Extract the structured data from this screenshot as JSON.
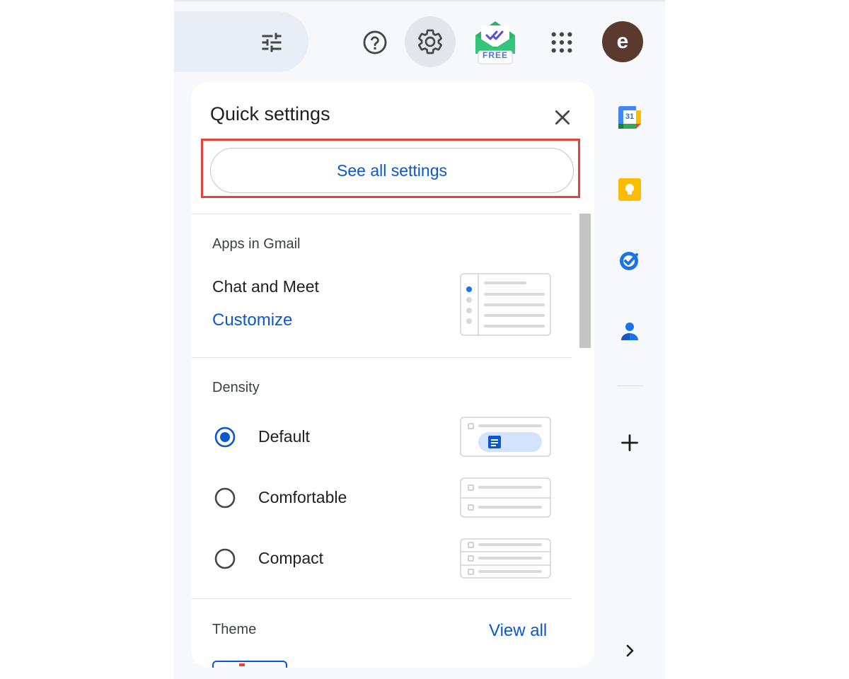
{
  "header": {
    "avatar_initial": "e",
    "extension_badge": "FREE"
  },
  "icons": {
    "filter": "tune-icon",
    "help": "help-circle-icon",
    "settings": "gear-icon",
    "apps": "apps-grid-icon",
    "close": "close-icon",
    "side_calendar": "google-calendar-icon",
    "side_keep": "google-keep-icon",
    "side_tasks": "google-tasks-icon",
    "side_contacts": "google-contacts-icon",
    "side_add": "plus-icon",
    "side_expand": "chevron-right-icon"
  },
  "calendar_day": "31",
  "quick_settings": {
    "title": "Quick settings",
    "see_all": "See all settings",
    "apps_section": {
      "label": "Apps in Gmail",
      "item": "Chat and Meet",
      "link": "Customize"
    },
    "density_section": {
      "label": "Density",
      "options": [
        {
          "label": "Default",
          "selected": true
        },
        {
          "label": "Comfortable",
          "selected": false
        },
        {
          "label": "Compact",
          "selected": false
        }
      ]
    },
    "theme_section": {
      "label": "Theme",
      "link": "View all"
    }
  },
  "colors": {
    "accent_blue": "#0b57d0",
    "highlight_red": "#e8413b",
    "avatar_bg": "#5a3a2e"
  }
}
